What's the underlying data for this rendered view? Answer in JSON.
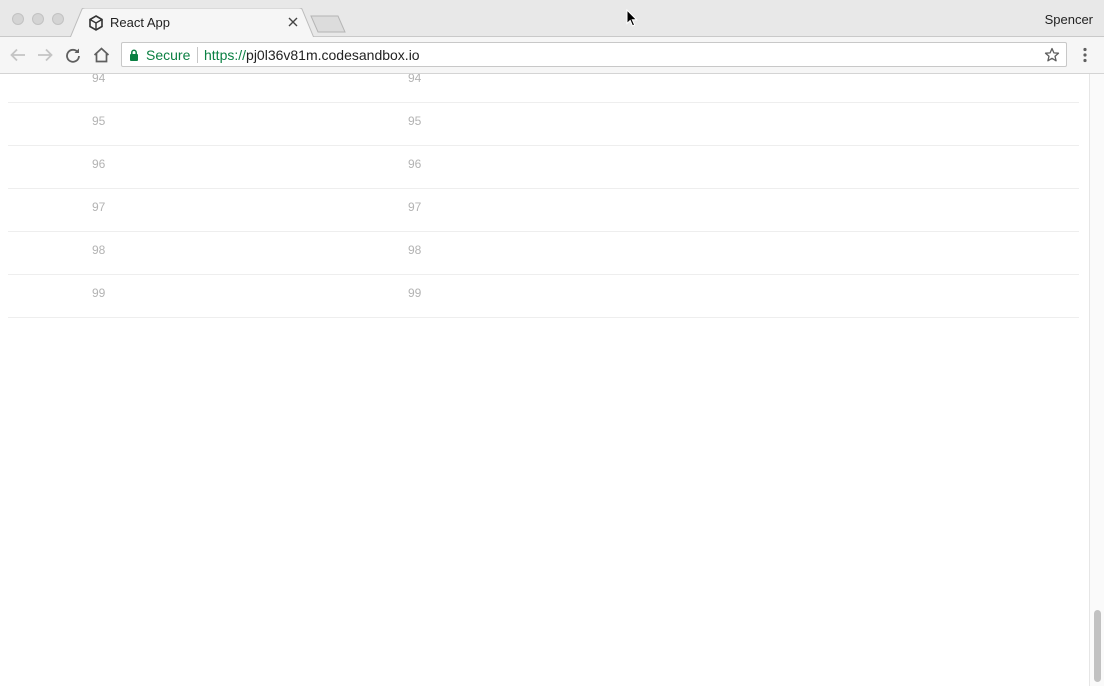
{
  "browser": {
    "tab": {
      "title": "React App",
      "favicon": "codesandbox-cube-icon"
    },
    "profile_name": "Spencer",
    "omnibox": {
      "security_label": "Secure",
      "url_scheme": "https://",
      "url_host": "pj0l36v81m.codesandbox.io"
    },
    "icons": {
      "back": "back-arrow-icon",
      "forward": "forward-arrow-icon",
      "reload": "reload-icon",
      "home": "home-icon",
      "bookmark": "star-icon",
      "menu": "vertical-dots-icon",
      "close_tab": "close-icon",
      "lock": "lock-icon"
    }
  },
  "table": {
    "rows": [
      {
        "col1": "94",
        "col2": "94"
      },
      {
        "col1": "95",
        "col2": "95"
      },
      {
        "col1": "96",
        "col2": "96"
      },
      {
        "col1": "97",
        "col2": "97"
      },
      {
        "col1": "98",
        "col2": "98"
      },
      {
        "col1": "99",
        "col2": "99"
      }
    ]
  },
  "scroll": {
    "position_fraction": 1.0,
    "visible_fraction": 0.13
  },
  "colors": {
    "secure_green": "#0b8043",
    "cell_text": "#b3b3b3",
    "row_divider": "#eeeeee"
  }
}
